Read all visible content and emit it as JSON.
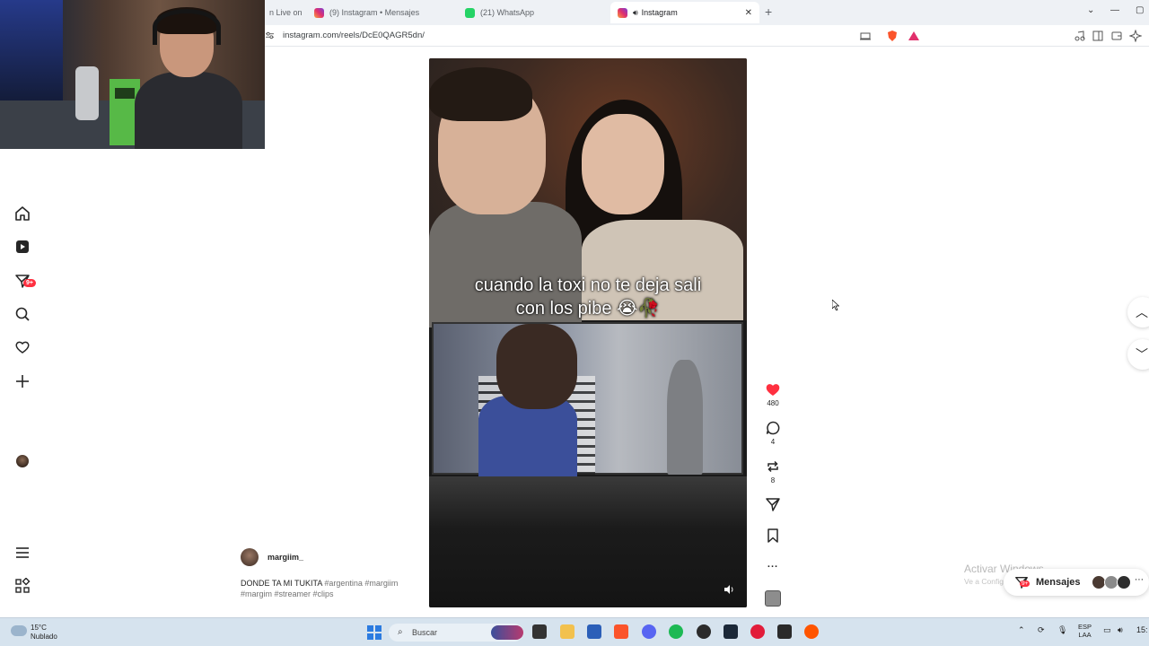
{
  "tabs": [
    {
      "label": "n Live on",
      "active": false
    },
    {
      "label": "(9) Instagram • Mensajes",
      "active": false
    },
    {
      "label": "(21) WhatsApp",
      "active": false
    },
    {
      "label": "Instagram",
      "active": true
    }
  ],
  "addressbar": {
    "url": "instagram.com/reels/DcE0QAGR5dn/"
  },
  "sidebar": {
    "messages_badge": "9+"
  },
  "reel": {
    "caption_line1": "cuando la toxi no te deja sali",
    "caption_line2": "con los pibe 😭🥀"
  },
  "actions": {
    "likes": "480",
    "comments": "4",
    "reposts": "8",
    "more": "..."
  },
  "author": {
    "username": "margiim_"
  },
  "description": {
    "text": "DONDE TA MI TUKITA",
    "tags_line1": " #argentina #margiim",
    "tags_line2": "#margim #streamer #clips"
  },
  "watermark": {
    "title": "Activar Windows",
    "subtitle": "Ve a Configuración para activar Windows."
  },
  "messages_bar": {
    "label": "Mensajes",
    "badge": "9+"
  },
  "taskbar": {
    "weather_temp": "15°C",
    "weather_desc": "Nublado",
    "search_placeholder": "Buscar",
    "lang_line1": "ESP",
    "lang_line2": "LAA",
    "clock": "15:"
  },
  "colors": {
    "like": "#ff3040",
    "badge": "#ff3040",
    "link": "#737373",
    "taskbar": "#d6e3ee"
  }
}
